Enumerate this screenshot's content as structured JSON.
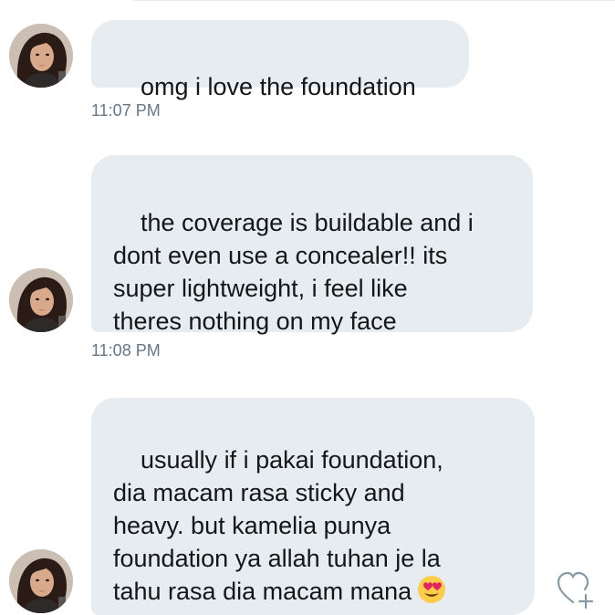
{
  "messages": [
    {
      "text": "omg i love the foundation",
      "time": "11:07 PM"
    },
    {
      "text": "the coverage is buildable and i\ndont even use a concealer!! its\nsuper lightweight, i feel like\ntheres nothing on my face",
      "time": "11:08 PM"
    },
    {
      "text": "usually if i pakai foundation,\ndia macam rasa sticky and\nheavy. but kamelia punya\nfoundation ya allah tuhan je la\ntahu rasa dia macam mana",
      "emoji": "heart-eyes-emoji"
    }
  ],
  "colors": {
    "bubble": "#e6ecf0",
    "timestamp": "#657786",
    "text": "#14171a",
    "like_icon": "#8899a6"
  },
  "icons": {
    "avatar": "profile-photo",
    "like": "heart-plus-icon"
  }
}
